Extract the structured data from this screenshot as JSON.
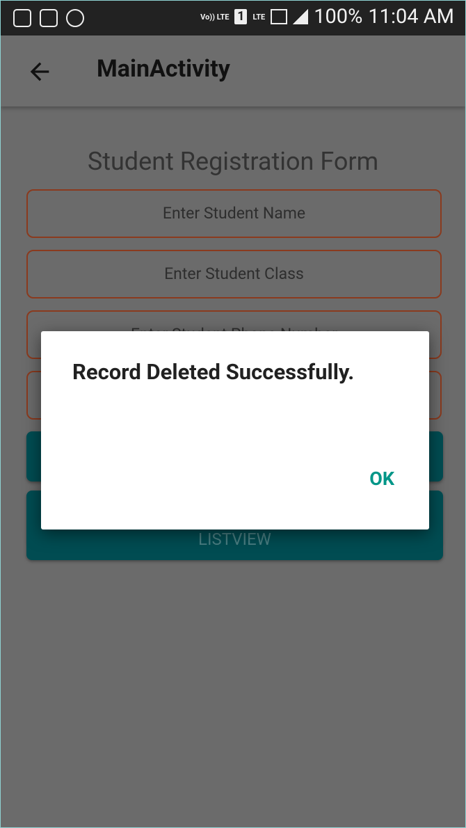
{
  "status_bar": {
    "network_label": "Vo)) LTE",
    "sim_label": "1",
    "lte_label": "LTE",
    "battery_percent": "100%",
    "time": "11:04 AM"
  },
  "app_bar": {
    "title": "MainActivity"
  },
  "form": {
    "title": "Student Registration Form",
    "name_placeholder": "Enter Student Name",
    "class_placeholder": "Enter Student Class",
    "phone_placeholder": "Enter Student Phone Number",
    "button_listview": "LISTVIEW"
  },
  "dialog": {
    "message": "Record Deleted Successfully.",
    "ok_label": "OK"
  }
}
